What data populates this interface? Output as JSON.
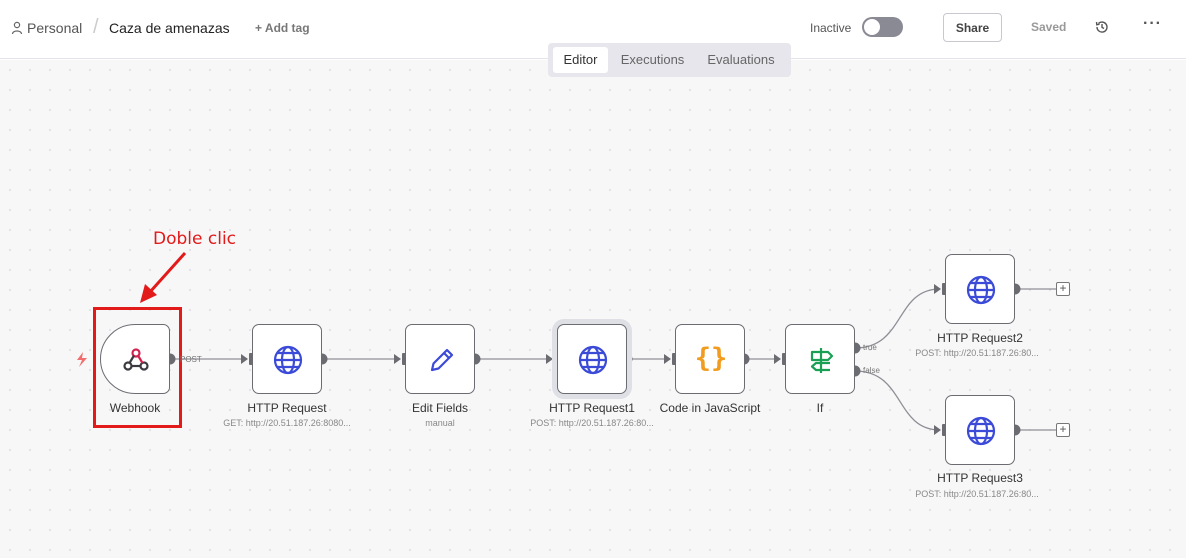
{
  "header": {
    "breadcrumb_parent": "Personal",
    "workflow_title": "Caza de amenazas",
    "add_tag": "+ Add tag",
    "status_label": "Inactive",
    "share": "Share",
    "saved": "Saved"
  },
  "tabs": [
    "Editor",
    "Executions",
    "Evaluations"
  ],
  "active_tab": "Editor",
  "annotation": "Doble clic",
  "nodes": {
    "webhook": {
      "title": "Webhook",
      "port": "POST"
    },
    "http1": {
      "title": "HTTP Request",
      "subtitle": "GET: http://20.51.187.26:8080..."
    },
    "edit": {
      "title": "Edit Fields",
      "subtitle": "manual"
    },
    "http2": {
      "title": "HTTP Request1",
      "subtitle": "POST: http://20.51.187.26:80..."
    },
    "code": {
      "title": "Code in JavaScript"
    },
    "if": {
      "title": "If",
      "true_label": "true",
      "false_label": "false"
    },
    "http3": {
      "title": "HTTP Request2",
      "subtitle": "POST: http://20.51.187.26:80..."
    },
    "http4": {
      "title": "HTTP Request3",
      "subtitle": "POST: http://20.51.187.26:80..."
    }
  },
  "colors": {
    "globe": "#3b4bd8",
    "code": "#f29c1f",
    "if": "#1aa055",
    "annotation": "#e21a1a",
    "webhook": "#d4224f"
  }
}
